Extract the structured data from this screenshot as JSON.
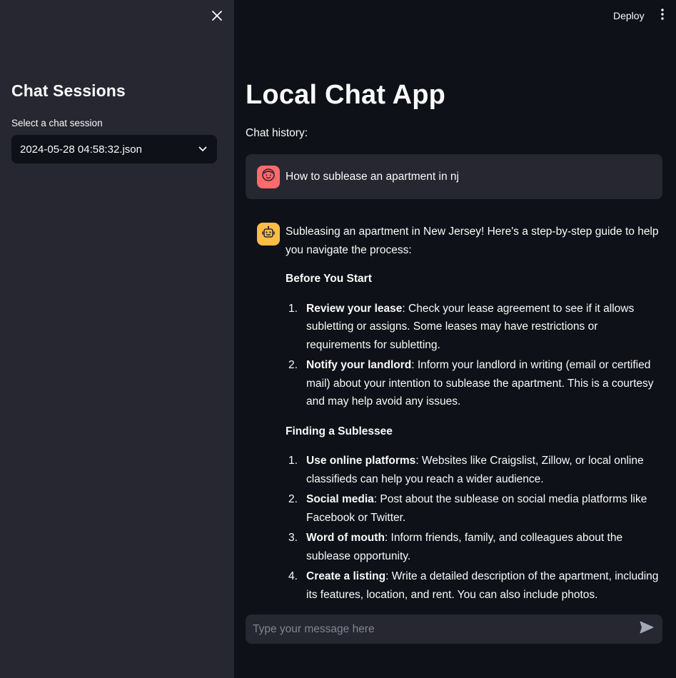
{
  "header": {
    "deploy_label": "Deploy",
    "menu_icon": "vertical-ellipsis-icon"
  },
  "sidebar": {
    "close_icon": "close-icon",
    "title": "Chat Sessions",
    "select": {
      "label": "Select a chat session",
      "value": "2024-05-28 04:58:32.json",
      "icon": "chevron-down-icon"
    }
  },
  "main": {
    "title": "Local Chat App",
    "history_label": "Chat history:",
    "messages": [
      {
        "role": "user",
        "avatar_icon": "user-face-icon",
        "text": "How to sublease an apartment in nj"
      },
      {
        "role": "assistant",
        "avatar_icon": "robot-icon",
        "intro": "Subleasing an apartment in New Jersey! Here's a step-by-step guide to help you navigate the process:",
        "sections": [
          {
            "heading": "Before You Start",
            "items": [
              {
                "num": "1.",
                "bold": "Review your lease",
                "text": ": Check your lease agreement to see if it allows subletting or assigns. Some leases may have restrictions or requirements for subletting."
              },
              {
                "num": "2.",
                "bold": "Notify your landlord",
                "text": ": Inform your landlord in writing (email or certified mail) about your intention to sublease the apartment. This is a courtesy and may help avoid any issues."
              }
            ]
          },
          {
            "heading": "Finding a Sublessee",
            "items": [
              {
                "num": "1.",
                "bold": "Use online platforms",
                "text": ": Websites like Craigslist, Zillow, or local online classifieds can help you reach a wider audience."
              },
              {
                "num": "2.",
                "bold": "Social media",
                "text": ": Post about the sublease on social media platforms like Facebook or Twitter."
              },
              {
                "num": "3.",
                "bold": "Word of mouth",
                "text": ": Inform friends, family, and colleagues about the sublease opportunity."
              },
              {
                "num": "4.",
                "bold": "Create a listing",
                "text": ": Write a detailed description of the apartment, including its features, location, and rent. You can also include photos."
              }
            ]
          }
        ]
      }
    ],
    "input": {
      "placeholder": "Type your message here",
      "value": "",
      "send_icon": "send-icon"
    }
  },
  "colors": {
    "background": "#0e1117",
    "sidebar": "#262730",
    "user_avatar": "#ff6b6b",
    "bot_avatar": "#ffbd45",
    "text": "#fafafa",
    "placeholder": "#808495"
  }
}
